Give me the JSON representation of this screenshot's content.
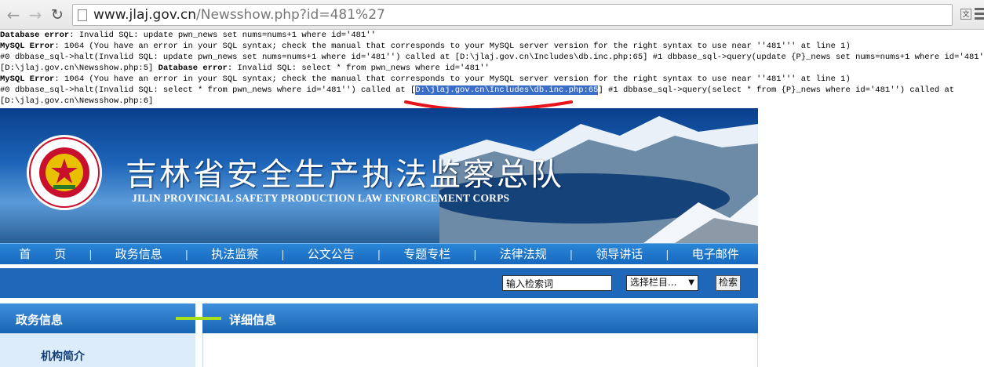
{
  "browser": {
    "url_host": "www.jlaj.gov.cn",
    "url_rest": "/Newsshow.php?id=481%27",
    "back_icon": "back-arrow-icon",
    "forward_icon": "forward-arrow-icon",
    "reload_icon": "reload-icon",
    "translate_glyph": "文"
  },
  "errors": {
    "l1_label": "Database error",
    "l1_text": ": Invalid SQL: update pwn_news set nums=nums+1 where id='481''",
    "l2_label": "MySQL Error",
    "l2_text": ": 1064 (You have an error in your SQL syntax; check the manual that corresponds to your MySQL server version for the right syntax to use near ''481''' at line 1)",
    "l3_text": "#0 dbbase_sql->halt(Invalid SQL: update pwn_news set nums=nums+1 where id='481'') called at [D:\\jlaj.gov.cn\\Includes\\db.inc.php:65] #1 dbbase_sql->query(update {P}_news set nums=nums+1 where id='481'') called at",
    "l4_text_a": "[D:\\jlaj.gov.cn\\Newsshow.php:5] ",
    "l4_label": "Database error",
    "l4_text_b": ": Invalid SQL: select * from pwn_news where id='481''",
    "l5_label": "MySQL Error",
    "l5_text": ": 1064 (You have an error in your SQL syntax; check the manual that corresponds to your MySQL server version for the right syntax to use near ''481''' at line 1)",
    "l6_text_a": "#0 dbbase_sql->halt(Invalid SQL: select * from pwn_news where id='481'') called at [",
    "l6_highlight": "D:\\jlaj.gov.cn\\Includes\\db.inc.php:65",
    "l6_text_b": "] #1 dbbase_sql->query(select * from {P}_news where id='481'') called at",
    "l7_text": "[D:\\jlaj.gov.cn\\Newsshow.php:6]",
    "annotation_color": "#e8141c"
  },
  "header": {
    "title_cn": "吉林省安全生产执法监察总队",
    "title_en": "JILIN PROVINCIAL SAFETY PRODUCTION LAW ENFORCEMENT CORPS",
    "emblem_icon": "star-emblem-icon"
  },
  "nav": {
    "items": [
      "首　　页",
      "政务信息",
      "执法监察",
      "公文公告",
      "专题专栏",
      "法律法规",
      "领导讲话",
      "电子邮件"
    ],
    "separator": "|"
  },
  "search": {
    "placeholder": "输入检索词",
    "select_value": "选择栏目...",
    "button_label": "检索"
  },
  "sidebar": {
    "heading": "政务信息",
    "items": [
      "机构简介"
    ]
  },
  "main": {
    "heading": "详细信息"
  },
  "colors": {
    "nav_blue": "#1668bd",
    "panel_blue": "#1864b3",
    "accent_green": "#a7e11d",
    "highlight": "#3b6fc7"
  }
}
